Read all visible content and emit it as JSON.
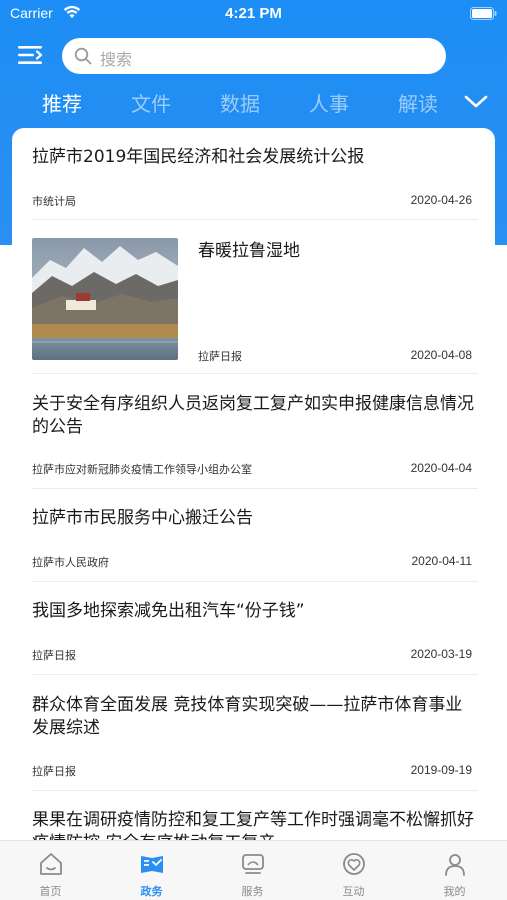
{
  "status_bar": {
    "carrier": "Carrier",
    "time": "4:21 PM"
  },
  "search": {
    "placeholder": "搜索"
  },
  "tabs": [
    {
      "label": "推荐",
      "active": true
    },
    {
      "label": "文件",
      "active": false
    },
    {
      "label": "数据",
      "active": false
    },
    {
      "label": "人事",
      "active": false
    },
    {
      "label": "解读",
      "active": false
    }
  ],
  "articles": [
    {
      "title": "拉萨市2019年国民经济和社会发展统计公报",
      "source": "市统计局",
      "date": "2020-04-26"
    },
    {
      "title": "春暖拉鲁湿地",
      "source": "拉萨日报",
      "date": "2020-04-08",
      "has_image": true
    },
    {
      "title": "关于安全有序组织人员返岗复工复产如实申报健康信息情况的公告",
      "source": "拉萨市应对新冠肺炎疫情工作领导小组办公室",
      "date": "2020-04-04"
    },
    {
      "title": "拉萨市市民服务中心搬迁公告",
      "source": "拉萨市人民政府",
      "date": "2020-04-11"
    },
    {
      "title": "我国多地探索减免出租汽车“份子钱”",
      "source": "拉萨日报",
      "date": "2020-03-19"
    },
    {
      "title": "群众体育全面发展 竞技体育实现突破——拉萨市体育事业发展综述",
      "source": "拉萨日报",
      "date": "2019-09-19"
    },
    {
      "title": "果果在调研疫情防控和复工复产等工作时强调毫不松懈抓好疫情防控 安全有序推动复工复产",
      "source": "",
      "date": ""
    }
  ],
  "bottom_nav": [
    {
      "label": "首页",
      "icon": "home-icon",
      "active": false
    },
    {
      "label": "政务",
      "icon": "government-icon",
      "active": true
    },
    {
      "label": "服务",
      "icon": "service-icon",
      "active": false
    },
    {
      "label": "互动",
      "icon": "interaction-icon",
      "active": false
    },
    {
      "label": "我的",
      "icon": "profile-icon",
      "active": false
    }
  ],
  "colors": {
    "brand_blue": "#2a8ff2",
    "inactive_gray": "#8a8a8a"
  }
}
